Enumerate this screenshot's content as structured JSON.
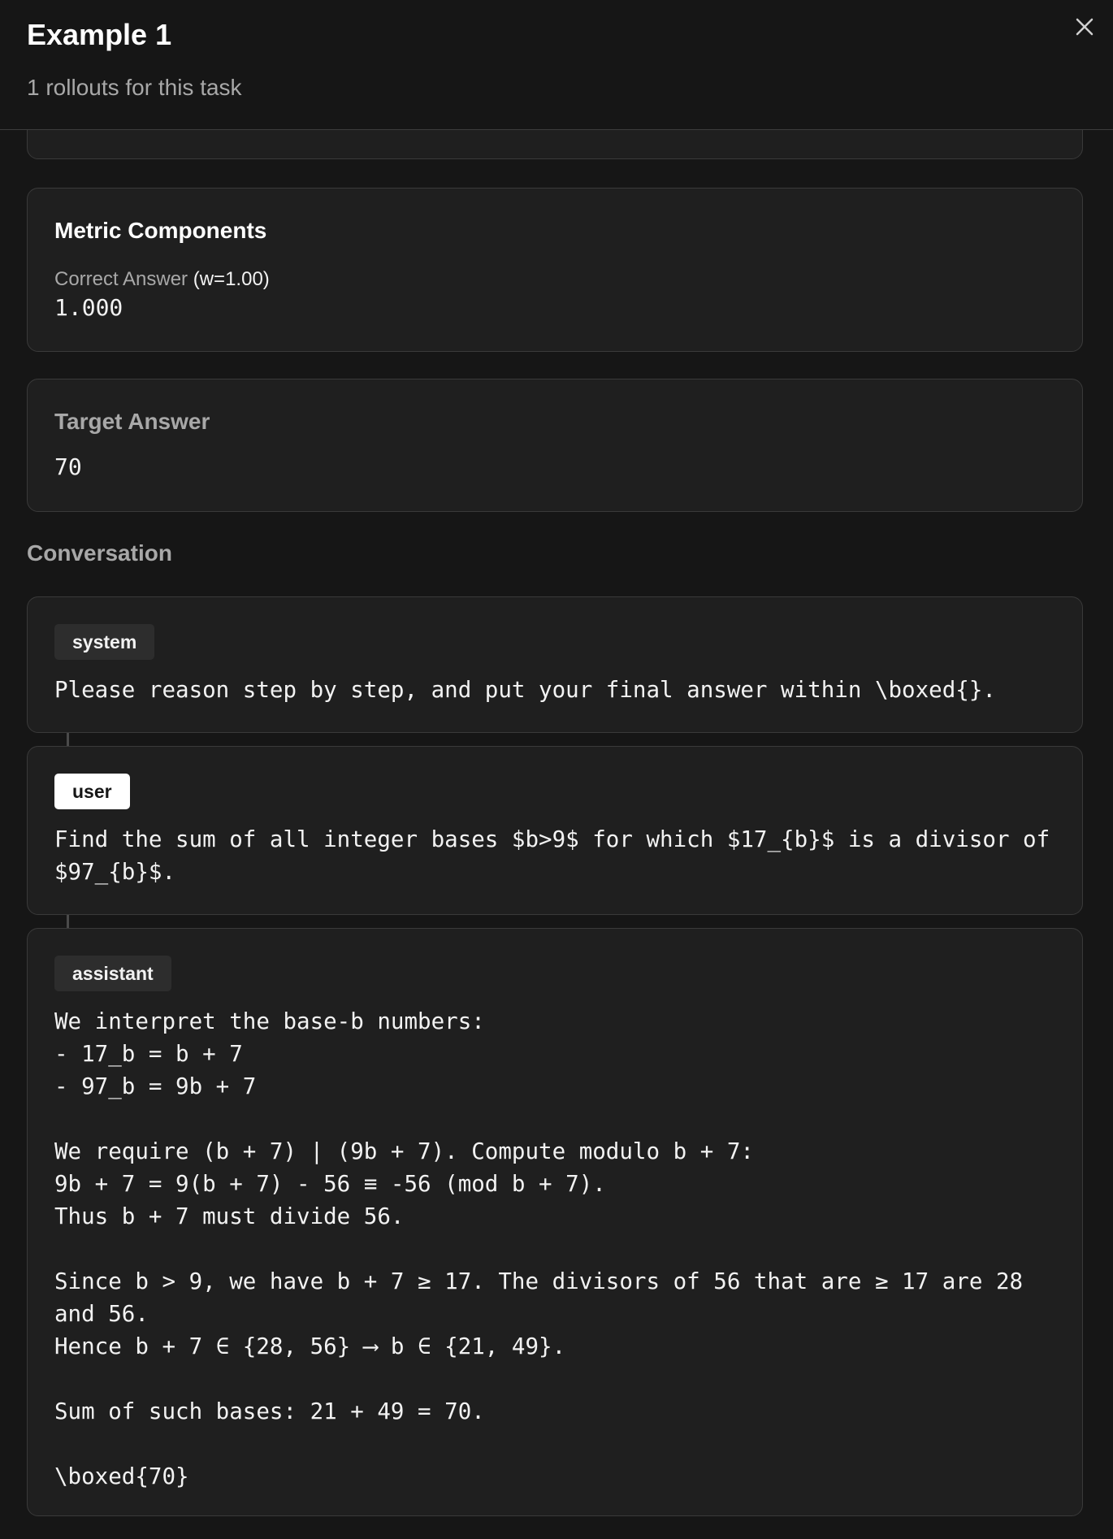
{
  "modal": {
    "title": "Example 1",
    "subtitle": "1 rollouts for this task"
  },
  "metrics": {
    "heading": "Metric Components",
    "items": [
      {
        "label": "Correct Answer",
        "weight": "(w=1.00)",
        "value": "1.000"
      }
    ]
  },
  "target": {
    "heading": "Target Answer",
    "value": "70"
  },
  "conversation": {
    "heading": "Conversation",
    "messages": [
      {
        "role": "system",
        "text": "Please reason step by step, and put your final answer within \\boxed{}."
      },
      {
        "role": "user",
        "text": "Find the sum of all integer bases $b>9$ for which $17_{b}$ is a divisor of $97_{b}$."
      },
      {
        "role": "assistant",
        "text": "We interpret the base-b numbers:\n- 17_b = b + 7\n- 97_b = 9b + 7\n\nWe require (b + 7) | (9b + 7). Compute modulo b + 7:\n9b + 7 = 9(b + 7) - 56 ≡ -56 (mod b + 7).\nThus b + 7 must divide 56.\n\nSince b > 9, we have b + 7 ≥ 17. The divisors of 56 that are ≥ 17 are 28 and 56.\nHence b + 7 ∈ {28, 56} ⟶ b ∈ {21, 49}.\n\nSum of such bases: 21 + 49 = 70.\n\n\\boxed{70}"
      }
    ]
  }
}
